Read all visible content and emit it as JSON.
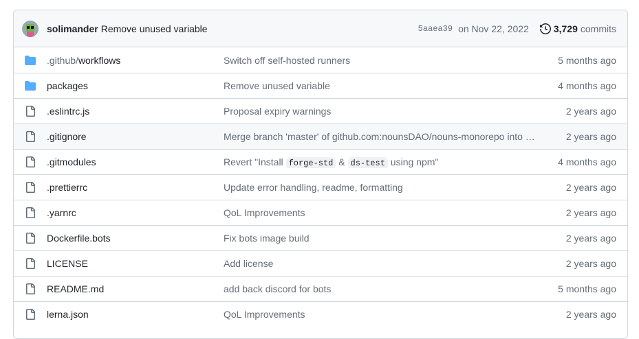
{
  "header": {
    "author": "solimander",
    "message": "Remove unused variable",
    "sha": "5aaea39",
    "date": "on Nov 22, 2022",
    "commits_count": "3,729",
    "commits_label": "commits"
  },
  "rows": [
    {
      "type": "folder",
      "name_prefix": ".github/",
      "name": "workflows",
      "message": "Switch off self-hosted runners",
      "age": "5 months ago"
    },
    {
      "type": "folder",
      "name_prefix": "",
      "name": "packages",
      "message": "Remove unused variable",
      "age": "4 months ago"
    },
    {
      "type": "file",
      "name_prefix": "",
      "name": ".eslintrc.js",
      "message": "Proposal expiry warnings",
      "age": "2 years ago"
    },
    {
      "type": "file",
      "name_prefix": "",
      "name": ".gitignore",
      "message": "Merge branch 'master' of github.com:nounsDAO/nouns-monorepo into …",
      "age": "2 years ago"
    },
    {
      "type": "file",
      "name_prefix": "",
      "name": ".gitmodules",
      "message_parts": [
        "Revert \"Install ",
        "forge-std",
        " & ",
        "ds-test",
        " using npm\""
      ],
      "age": "4 months ago"
    },
    {
      "type": "file",
      "name_prefix": "",
      "name": ".prettierrc",
      "message": "Update error handling, readme, formatting",
      "age": "2 years ago"
    },
    {
      "type": "file",
      "name_prefix": "",
      "name": ".yarnrc",
      "message": "QoL Improvements",
      "age": "2 years ago"
    },
    {
      "type": "file",
      "name_prefix": "",
      "name": "Dockerfile.bots",
      "message": "Fix bots image build",
      "age": "2 years ago"
    },
    {
      "type": "file",
      "name_prefix": "",
      "name": "LICENSE",
      "message": "Add license",
      "age": "2 years ago"
    },
    {
      "type": "file",
      "name_prefix": "",
      "name": "README.md",
      "message": "add back discord for bots",
      "age": "5 months ago"
    },
    {
      "type": "file",
      "name_prefix": "",
      "name": "lerna.json",
      "message": "QoL Improvements",
      "age": "2 years ago"
    }
  ],
  "colors": {
    "folder": "#54aeff",
    "file": "#656d76",
    "hover_row": "#f6f8fa"
  },
  "icons": {
    "folder": "folder-icon",
    "file": "file-icon",
    "history": "history-icon"
  }
}
